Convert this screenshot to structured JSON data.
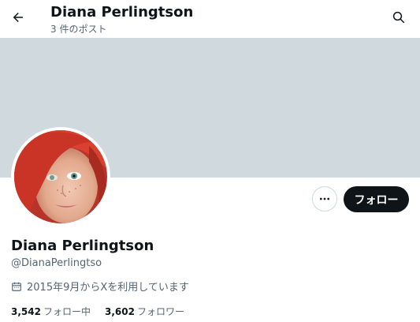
{
  "header": {
    "title": "Diana Perlingtson",
    "subtitle": "3 件のポスト"
  },
  "icons": {
    "back": "arrow-left-icon",
    "search": "search-icon",
    "more": "more-horizontal-icon",
    "calendar": "calendar-icon"
  },
  "actions": {
    "follow_label": "フォロー"
  },
  "profile": {
    "name": "Diana Perlingtson",
    "handle": "@DianaPerlingtso",
    "joined": "2015年9月からXを利用しています"
  },
  "stats": {
    "following_count": "3,542",
    "following_label": "フォロー中",
    "followers_count": "3,602",
    "followers_label": "フォロワー"
  },
  "colors": {
    "banner": "#cfd9de",
    "primary_button": "#0f1419",
    "secondary_text": "#536471"
  }
}
